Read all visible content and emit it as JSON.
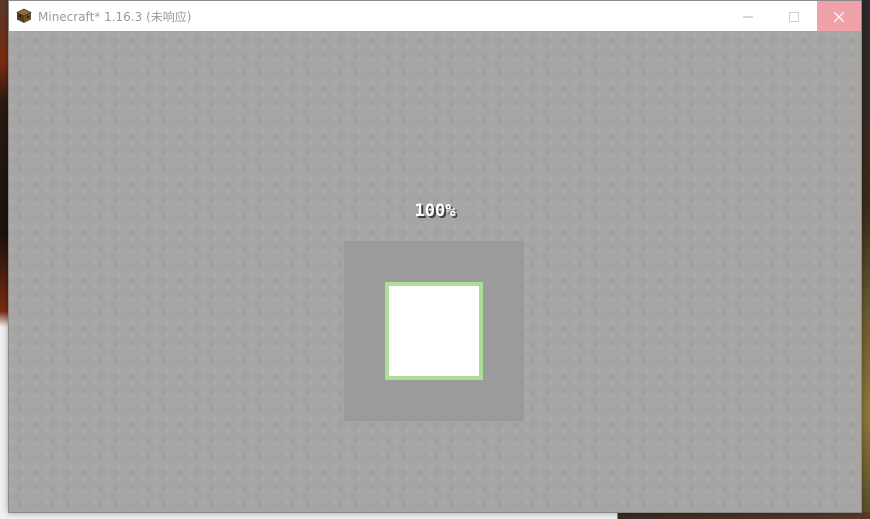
{
  "window": {
    "title": "Minecraft* 1.16.3 (未响应)",
    "app_icon": "minecraft-grass-block-icon",
    "controls": [
      "minimize-icon",
      "maximize-icon",
      "close-icon"
    ]
  },
  "loading": {
    "percent_text": "100%",
    "progress": 1.0
  },
  "colors": {
    "background": "#a7a5a3",
    "box_outer": "#9c9b9b",
    "box_inner": "#ffffff",
    "box_border": "#a9df96",
    "close_hover": "#f1a1aa"
  }
}
